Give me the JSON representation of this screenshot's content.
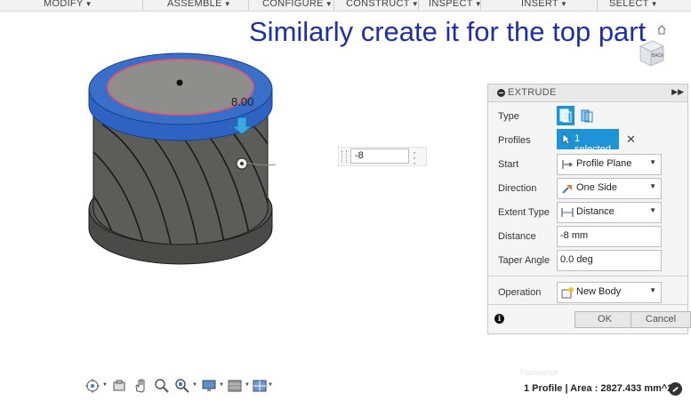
{
  "menu": [
    {
      "key": "modify",
      "label": "MODIFY"
    },
    {
      "key": "assemble",
      "label": "ASSEMBLE"
    },
    {
      "key": "configure",
      "label": "CONFIGURE"
    },
    {
      "key": "construct",
      "label": "CONSTRUCT"
    },
    {
      "key": "inspect",
      "label": "INSPECT"
    },
    {
      "key": "insert",
      "label": "INSERT"
    },
    {
      "key": "select",
      "label": "SELECT"
    }
  ],
  "caption": "Similarly create it for the top part",
  "viewcube": {
    "face_label": "BACK"
  },
  "viewport": {
    "dimension_label": "8.00"
  },
  "mini_input": {
    "value": "-8"
  },
  "extrude": {
    "title": "EXTRUDE",
    "type_label": "Type",
    "profiles_label": "Profiles",
    "profiles_value": "1 selected",
    "start_label": "Start",
    "start_value": "Profile Plane",
    "direction_label": "Direction",
    "direction_value": "One Side",
    "extent_label": "Extent Type",
    "extent_value": "Distance",
    "distance_label": "Distance",
    "distance_value": "-8 mm",
    "taper_label": "Taper Angle",
    "taper_value": "0.0 deg",
    "operation_label": "Operation",
    "operation_value": "New Body",
    "ok": "OK",
    "cancel": "Cancel"
  },
  "status": "1 Profile | Area : 2827.433 mm^2",
  "watermark": "Flameshot",
  "colors": {
    "accent": "#1e93d6",
    "caption": "#1d2fa6",
    "spool_top": "#3a6fc9",
    "profile_edge": "#e05a6a"
  }
}
